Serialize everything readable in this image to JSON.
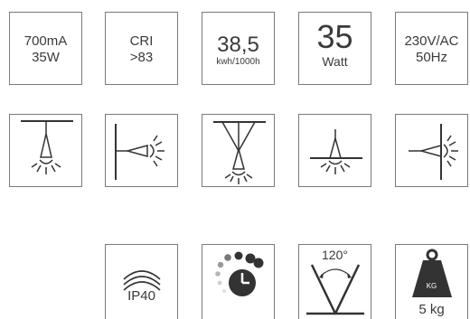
{
  "specs": {
    "current_power": {
      "line1": "700mA",
      "line2": "35W"
    },
    "cri": {
      "line1": "CRI",
      "line2": ">83"
    },
    "energy": {
      "value": "38,5",
      "unit": "kwh/1000h"
    },
    "watt": {
      "value": "35",
      "unit": "Watt"
    },
    "voltage": {
      "line1": "230V/AC",
      "line2": "50Hz"
    }
  },
  "mounting_icons": [
    "ceiling-mounted-lamp-icon",
    "wall-mounted-lamp-icon",
    "pendant-lamp-icon",
    "recessed-lamp-icon",
    "recessed-wall-lamp-icon"
  ],
  "features": {
    "ip_rating": {
      "label": "IP40"
    },
    "dimming": {
      "icon": "dimmer-timer-icon"
    },
    "beam_angle": {
      "label": "120°"
    },
    "weight": {
      "label": "5 kg",
      "badge": "KG"
    }
  }
}
